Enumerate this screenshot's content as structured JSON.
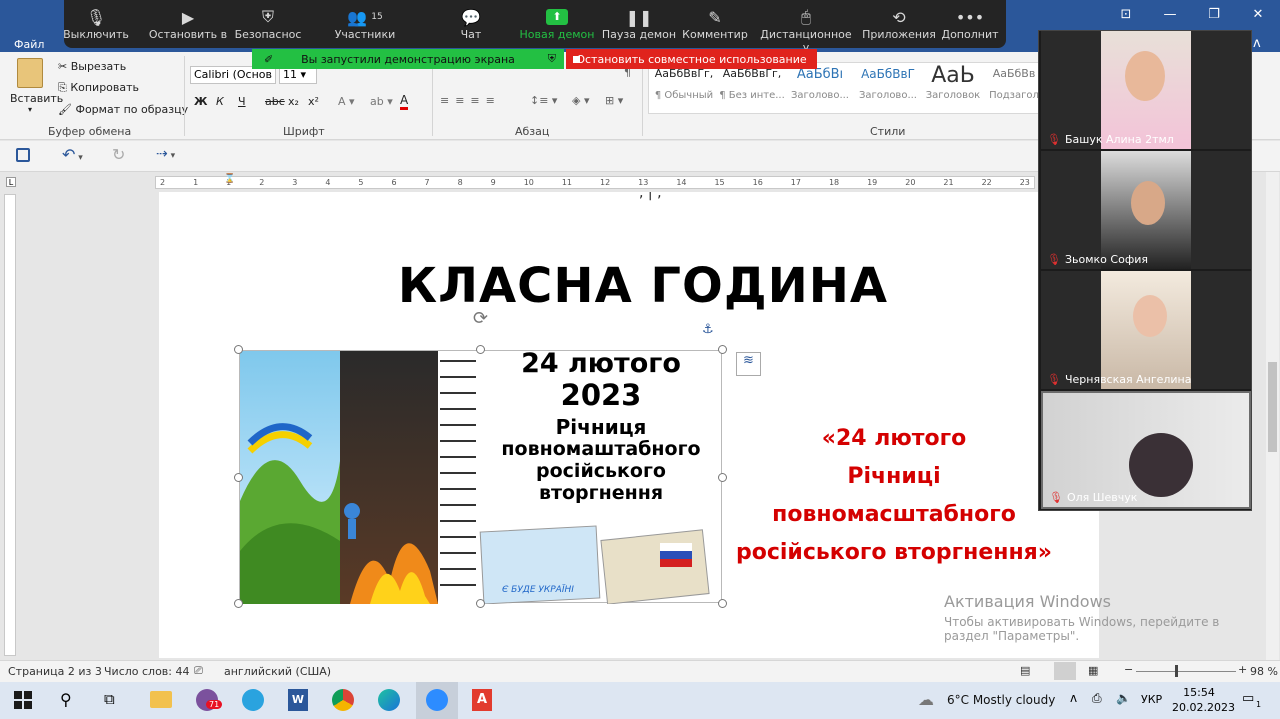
{
  "word": {
    "tab_file": "Файл",
    "ribbon": {
      "clipboard": {
        "paste": "Вставить",
        "cut": "Вырезать",
        "copy": "Копировать",
        "format_painter": "Формат по образцу",
        "group": "Буфер обмена"
      },
      "font": {
        "name": "Calibri (Основ",
        "size": "11",
        "bold": "Ж",
        "italic": "К",
        "underline": "Ч",
        "strike": "abc",
        "sub": "x₂",
        "sup": "x²",
        "group": "Шрифт"
      },
      "paragraph": {
        "group": "Абзац"
      },
      "styles": {
        "group": "Стили",
        "items": [
          {
            "preview": "АаБбВвГг,",
            "name": "¶ Обычный"
          },
          {
            "preview": "АаБбВвГг,",
            "name": "¶ Без инте..."
          },
          {
            "preview": "АаБбВı",
            "name": "Заголово..."
          },
          {
            "preview": "АаБбВвГ",
            "name": "Заголово..."
          },
          {
            "preview": "АаЬ",
            "name": "Заголовок"
          },
          {
            "preview": "АаБбВв",
            "name": "Подзагол"
          }
        ]
      }
    },
    "ruler_numbers": [
      "2",
      "1",
      "1",
      "2",
      "3",
      "4",
      "5",
      "6",
      "7",
      "8",
      "9",
      "10",
      "11",
      "12",
      "13",
      "14",
      "15",
      "16",
      "17",
      "18",
      "19",
      "20",
      "21",
      "22",
      "23"
    ],
    "document": {
      "title": "КЛАСНА ГОДИНА",
      "picture": {
        "date_line": "24 лютого",
        "year": "2023",
        "line1": "Річниця",
        "line2": "повномаштабного",
        "line3": "російського",
        "line4": "вторгнення",
        "postcard_caption": "Є БУДЕ УКРАЇНІ"
      },
      "red_text": [
        "«24 лютого",
        "Річниці",
        "повномасштабного",
        "російського вторгнення»"
      ]
    },
    "activation": {
      "title": "Активация Windows",
      "line1": "Чтобы активировать Windows, перейдите в",
      "line2": "раздел \"Параметры\"."
    },
    "status": {
      "page": "Страница 2 из 3",
      "words": "Число слов: 44",
      "language": "английский (США)",
      "zoom": "98 %"
    }
  },
  "zoom": {
    "toolbar": [
      {
        "label": "Выключить",
        "icon": "mic-icon",
        "glyph": "🎤"
      },
      {
        "label": "Остановить в",
        "icon": "video-icon",
        "glyph": "▶"
      },
      {
        "label": "Безопаснос",
        "icon": "shield-icon",
        "glyph": "⛨"
      },
      {
        "label": "Участники",
        "icon": "participants-icon",
        "glyph": "👥"
      },
      {
        "label": "Чат",
        "icon": "chat-icon",
        "glyph": "💬"
      },
      {
        "label": "Новая демон",
        "icon": "share-screen-icon",
        "glyph": "⬆"
      },
      {
        "label": "Пауза демон",
        "icon": "pause-icon",
        "glyph": "❚❚"
      },
      {
        "label": "Комментир",
        "icon": "annotate-icon",
        "glyph": "✎"
      },
      {
        "label": "Дистанционное у",
        "icon": "remote-control-icon",
        "glyph": "🖱"
      },
      {
        "label": "Приложения",
        "icon": "apps-icon",
        "glyph": "⟲"
      },
      {
        "label": "Дополнит",
        "icon": "more-icon",
        "glyph": "•••"
      }
    ],
    "participants_count": "15",
    "banner_sharing": "Вы запустили демонстрацию экрана",
    "banner_stop": "Остановить совместное использование",
    "participants": [
      {
        "name": "Башук Алина 2тмл"
      },
      {
        "name": "Зьомко София"
      },
      {
        "name": "Чернявская Ангелина"
      },
      {
        "name": "Оля Шевчук"
      }
    ]
  },
  "taskbar": {
    "weather": "6°C  Mostly cloudy",
    "lang": "УКР",
    "time": "15:54",
    "date": "20.02.2023",
    "viber_badge": "71",
    "notifications": "1"
  }
}
